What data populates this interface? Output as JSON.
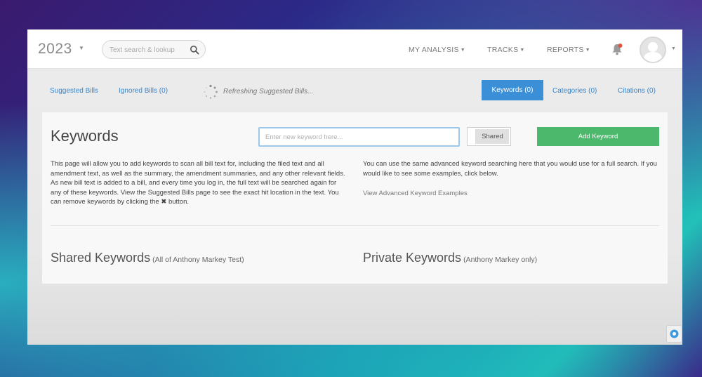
{
  "header": {
    "year": "2023",
    "search_placeholder": "Text search & lookup",
    "nav": [
      "MY ANALYSIS",
      "TRACKS",
      "REPORTS"
    ]
  },
  "subnav": {
    "suggested": "Suggested Bills",
    "ignored": "Ignored Bills (0)",
    "refreshing": "Refreshing Suggested Bills...",
    "tabs": [
      "Keywords (0)",
      "Categories (0)",
      "Citations (0)"
    ]
  },
  "keywords": {
    "title": "Keywords",
    "input_placeholder": "Enter new keyword here...",
    "shared_label": "Shared",
    "add_button": "Add Keyword",
    "description_left": "This page will allow you to add keywords to scan all bill text for, including the filed text and all amendment text, as well as the summary, the amendment summaries, and any other relevant fields. As new bill text is added to a bill, and every time you log in, the full text will be searched again for any of these keywords. View the Suggested Bills page to see the exact hit location in the text. You can remove keywords by clicking the ✖ button.",
    "description_right": "You can use the same advanced keyword searching here that you would use for a full search. If you would like to see some examples, click below.",
    "examples_link": "View Advanced Keyword Examples",
    "shared_title": "Shared Keywords",
    "shared_sub": "(All of Anthony Markey Test)",
    "private_title": "Private Keywords",
    "private_sub": "(Anthony Markey only)"
  },
  "colors": {
    "accent_blue": "#3a8fd6",
    "add_green": "#4cb86c",
    "link_blue": "#3a86c8"
  }
}
